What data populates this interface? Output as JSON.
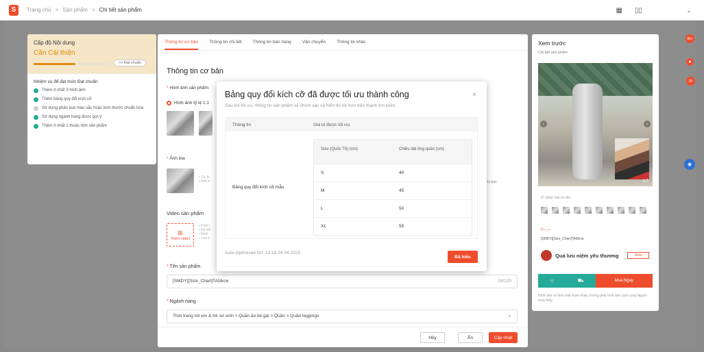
{
  "breadcrumb": {
    "home": "Trang chủ",
    "sep1": ">",
    "products": "Sản phẩm",
    "sep2": ">",
    "current": "Chi tiết sản phẩm"
  },
  "left_card": {
    "title": "Cấp độ Nội dung",
    "status": "Cần Cải thiện",
    "progress_percent": 55,
    "badge": ">> Đạt chuẩn",
    "tasks_title": "Nhiệm vụ để đạt mức Đạt chuẩn",
    "tasks": [
      {
        "label": "Thêm ít nhất 3 hình ảnh",
        "done": true
      },
      {
        "label": "Thêm bảng quy đổi kích cỡ",
        "done": true
      },
      {
        "label": "Sử dụng phân loại màu sắc hoặc kích thước chuẩn hóa",
        "done": false
      },
      {
        "label": "Sử dụng ngành hàng được gợi ý",
        "done": true
      },
      {
        "label": "Thêm ít nhất 1 thuộc tính sản phẩm",
        "done": true
      }
    ]
  },
  "tabs": [
    "Thông tin cơ bản",
    "Thông tin chi tiết",
    "Thông tin bán hàng",
    "Vận chuyển",
    "Thông tin khác"
  ],
  "main": {
    "section_title": "Thông tin cơ bản",
    "images_label": "Hình ảnh sản phẩm",
    "ratio_label": "Hình ảnh tỷ lệ 1:1",
    "cover_label": "Ảnh bìa",
    "video_label": "Video sản phẩm",
    "video_button": "Thêm video",
    "name_label": "Tên sản phẩm",
    "name_value": "[SMDY][Size_Chart]TA5bcw",
    "name_counter": "24/120",
    "category_label": "Ngành hàng",
    "category_value": "Thời trang trẻ em & trẻ sơ sinh > Quần áo bé gái > Quần > Quần leggings",
    "side_hint": "của bạn",
    "cancel": "Hủy",
    "hide": "Ẩn",
    "update": "Cập nhật"
  },
  "preview": {
    "title": "Xem trước",
    "subtitle": "Chi tiết sản phẩm",
    "image_counter": "1/7",
    "variant_count": "57 phân loại có sẵn",
    "price": "₫--,---",
    "product_name": "[SMDY][Size_Chart]TA5bcw",
    "shop_name": "Quả lưu niệm yêu thương",
    "follow": "Xem",
    "buy_now": "Mua Ngay",
    "note": "Hình ảnh có tính chất tham khảo, không phải hình ảnh cuối cùng Người mua thấy."
  },
  "floating": {
    "badge1": "99+",
    "badge2": "25"
  },
  "modal": {
    "title": "Bảng quy đổi kích cỡ đã được tối ưu thành công",
    "close": "×",
    "description": "Sau khi tối ưu, thông tin sản phẩm sẽ chính xác và hiển thị tốt hơn trên thanh tìm kiếm.",
    "col_info": "Thông tin",
    "col_value": "Giá trị được tối ưu",
    "row_label": "Bảng quy đổi kích cỡ mẫu",
    "size_header": "Size (Quốc Tế) (cm)",
    "length_header": "Chiều dài ống quần (cm)",
    "rows": [
      {
        "size": "S",
        "length": "40"
      },
      {
        "size": "M",
        "length": "45"
      },
      {
        "size": "L",
        "length": "50"
      },
      {
        "size": "XL",
        "length": "55"
      }
    ],
    "footer": "Auto-Optimised On: 13:18 24-04-2025",
    "ok": "Đã hiểu"
  }
}
